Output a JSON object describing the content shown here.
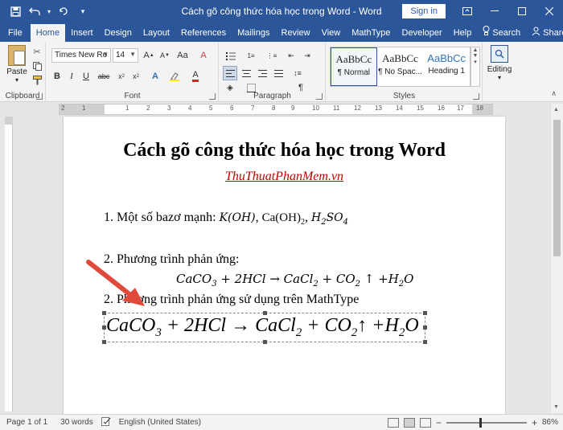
{
  "window": {
    "title": "Cách gõ công thức hóa học trong Word  -  Word",
    "signin_label": "Sign in",
    "accent_color": "#2b579a"
  },
  "qat": {
    "save_icon": "save-icon",
    "undo_icon": "undo-icon",
    "redo_icon": "redo-icon",
    "customize_icon": "customize-qat-icon"
  },
  "tabs": [
    {
      "label": "File"
    },
    {
      "label": "Home"
    },
    {
      "label": "Insert"
    },
    {
      "label": "Design"
    },
    {
      "label": "Layout"
    },
    {
      "label": "References"
    },
    {
      "label": "Mailings"
    },
    {
      "label": "Review"
    },
    {
      "label": "View"
    },
    {
      "label": "MathType"
    },
    {
      "label": "Developer"
    },
    {
      "label": "Help"
    }
  ],
  "tab_right": {
    "search_label": "Search",
    "share_label": "Share"
  },
  "ribbon": {
    "clipboard": {
      "paste_label": "Paste",
      "group_label": "Clipboard"
    },
    "font": {
      "font_name": "Times New Ro",
      "font_size": "14",
      "group_label": "Font"
    },
    "paragraph": {
      "group_label": "Paragraph"
    },
    "styles": {
      "items": [
        {
          "sample": "AaBbCc",
          "name": "¶ Normal"
        },
        {
          "sample": "AaBbCc",
          "name": "¶ No Spac..."
        },
        {
          "sample": "AaBbCc",
          "name": "Heading 1"
        }
      ],
      "group_label": "Styles"
    },
    "editing": {
      "label": "Editing"
    }
  },
  "ruler": {
    "numbers": [
      "2",
      "1",
      "1",
      "2",
      "3",
      "4",
      "5",
      "6",
      "7",
      "8",
      "9",
      "10",
      "11",
      "12",
      "13",
      "14",
      "15",
      "16",
      "17",
      "18"
    ]
  },
  "document": {
    "title": "Cách gõ công thức hóa học trong Word",
    "link": "ThuThuatPhanMem.vn",
    "para1_label": "1. Một số bazơ mạnh: ",
    "para1_math1": "K(OH)",
    "para1_sep1": ", ",
    "para1_math2": "Ca(OH)",
    "para1_sub2": "2",
    "para1_sep2": ", ",
    "para1_math3_a": "H",
    "para1_math3_s1": "2",
    "para1_math3_b": "SO",
    "para1_math3_s2": "4",
    "para2_label": "2. Phương trình phản ứng:",
    "eq1": {
      "p1": "CaCO",
      "s1": "3",
      "p2": " + 2HCl → CaCl",
      "s2": "2",
      "p3": " + CO",
      "s3": "2",
      "p4": " ↑ +H",
      "s4": "2",
      "p5": "O"
    },
    "para3_label": "2. Phương trình phản ứng sử dụng trên MathType",
    "eq2": {
      "p1": "CaCO",
      "s1": "3",
      "p2": " + 2HCl → CaCl",
      "s2": "2",
      "p3": " + CO",
      "s3": "2",
      "p4": "↑ +H",
      "s4": "2",
      "p5": "O"
    }
  },
  "statusbar": {
    "page": "Page 1 of 1",
    "words": "30 words",
    "language": "English (United States)",
    "zoom": "86%",
    "zoom_level": 86
  }
}
